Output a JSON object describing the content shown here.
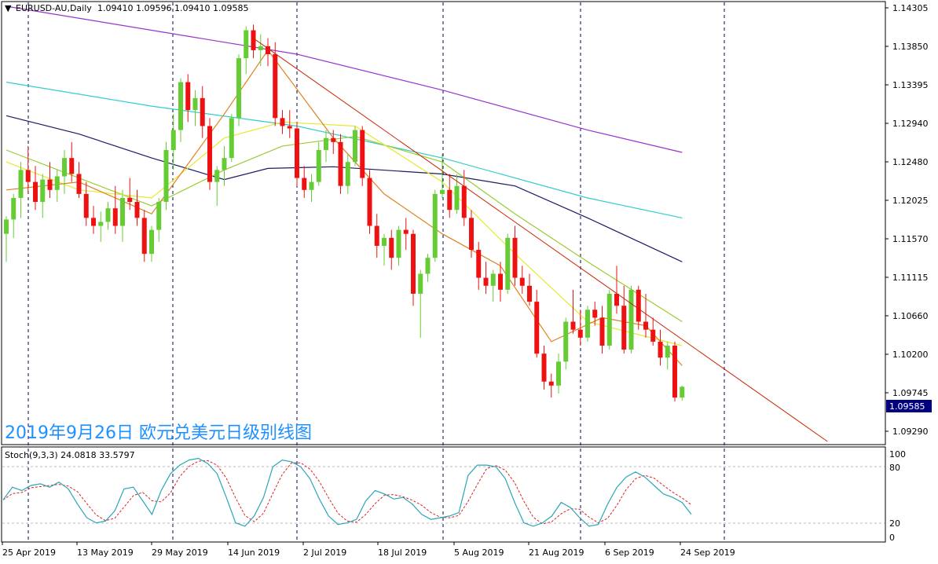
{
  "header": {
    "symbol": "EURUSD-AU,Daily",
    "ohlc": "1.09410 1.09596 1.09410 1.09585"
  },
  "caption": "2019年9月26日 欧元兑美元日级别线图",
  "price_tag": "1.09585",
  "stoch": {
    "label": "Stoch(9,3,3) 24.0818 33.5797",
    "levels": [
      "100",
      "80",
      "20",
      "0"
    ]
  },
  "price_axis": [
    "1.14305",
    "1.13850",
    "1.13395",
    "1.12940",
    "1.12480",
    "1.12025",
    "1.11570",
    "1.11115",
    "1.10660",
    "1.10200",
    "1.09745",
    "1.09290"
  ],
  "date_axis": [
    "25 Apr 2019",
    "13 May 2019",
    "29 May 2019",
    "14 Jun 2019",
    "2 Jul 2019",
    "18 Jul 2019",
    "5 Aug 2019",
    "21 Aug 2019",
    "6 Sep 2019",
    "24 Sep 2019"
  ],
  "colors": {
    "bull": "#66cc33",
    "bear": "#ee1111",
    "trendline": "#cc2200",
    "ma_purple": "#9933cc",
    "ma_cyan": "#33cccc",
    "ma_navy": "#1a1a66",
    "ma_green": "#99cc33",
    "ma_yellow": "#e8e830",
    "ma_orange": "#e08020",
    "stoch_main": "#2aa6b8",
    "stoch_signal": "#dd2222",
    "caption": "#1e90ff"
  },
  "chart_data": {
    "type": "candlestick",
    "title": "EURUSD-AU,Daily",
    "ylim": [
      1.089,
      1.1435
    ],
    "candles": [
      [
        1.115,
        1.1172,
        1.1115,
        1.1168
      ],
      [
        1.1168,
        1.12,
        1.1145,
        1.1195
      ],
      [
        1.1195,
        1.124,
        1.117,
        1.123
      ],
      [
        1.123,
        1.126,
        1.12,
        1.1215
      ],
      [
        1.1215,
        1.1235,
        1.118,
        1.119
      ],
      [
        1.119,
        1.1225,
        1.117,
        1.1218
      ],
      [
        1.1218,
        1.124,
        1.1195,
        1.1205
      ],
      [
        1.1205,
        1.123,
        1.119,
        1.1222
      ],
      [
        1.1222,
        1.1255,
        1.12,
        1.1245
      ],
      [
        1.1245,
        1.1265,
        1.1215,
        1.1225
      ],
      [
        1.1225,
        1.124,
        1.1195,
        1.12
      ],
      [
        1.12,
        1.1215,
        1.116,
        1.117
      ],
      [
        1.117,
        1.1185,
        1.115,
        1.116
      ],
      [
        1.116,
        1.1178,
        1.114,
        1.1165
      ],
      [
        1.1165,
        1.119,
        1.1155,
        1.1182
      ],
      [
        1.1182,
        1.121,
        1.115,
        1.116
      ],
      [
        1.116,
        1.1205,
        1.114,
        1.1195
      ],
      [
        1.1195,
        1.122,
        1.118,
        1.119
      ],
      [
        1.119,
        1.1205,
        1.116,
        1.117
      ],
      [
        1.117,
        1.118,
        1.1115,
        1.1125
      ],
      [
        1.1125,
        1.116,
        1.1115,
        1.1155
      ],
      [
        1.1155,
        1.1195,
        1.114,
        1.119
      ],
      [
        1.119,
        1.1265,
        1.118,
        1.1255
      ],
      [
        1.1255,
        1.13,
        1.123,
        1.128
      ],
      [
        1.128,
        1.1345,
        1.1265,
        1.134
      ],
      [
        1.134,
        1.135,
        1.129,
        1.1305
      ],
      [
        1.1305,
        1.133,
        1.1285,
        1.132
      ],
      [
        1.132,
        1.1335,
        1.127,
        1.1285
      ],
      [
        1.1285,
        1.1295,
        1.1205,
        1.1215
      ],
      [
        1.1215,
        1.1235,
        1.1185,
        1.123
      ],
      [
        1.123,
        1.126,
        1.121,
        1.1245
      ],
      [
        1.1245,
        1.13,
        1.124,
        1.1295
      ],
      [
        1.1295,
        1.1375,
        1.1285,
        1.137
      ],
      [
        1.137,
        1.141,
        1.135,
        1.1405
      ],
      [
        1.1405,
        1.1412,
        1.137,
        1.138
      ],
      [
        1.138,
        1.14,
        1.136,
        1.1385
      ],
      [
        1.1385,
        1.1395,
        1.136,
        1.1375
      ],
      [
        1.1375,
        1.139,
        1.1285,
        1.1295
      ],
      [
        1.1295,
        1.1305,
        1.1275,
        1.1285
      ],
      [
        1.1285,
        1.1305,
        1.127,
        1.1282
      ],
      [
        1.1282,
        1.129,
        1.121,
        1.122
      ],
      [
        1.122,
        1.1235,
        1.1195,
        1.1205
      ],
      [
        1.1205,
        1.1225,
        1.119,
        1.1215
      ],
      [
        1.1215,
        1.1265,
        1.121,
        1.1255
      ],
      [
        1.1255,
        1.128,
        1.124,
        1.127
      ],
      [
        1.127,
        1.128,
        1.125,
        1.1265
      ],
      [
        1.1265,
        1.1275,
        1.12,
        1.121
      ],
      [
        1.121,
        1.125,
        1.12,
        1.124
      ],
      [
        1.124,
        1.1285,
        1.1235,
        1.128
      ],
      [
        1.128,
        1.1285,
        1.121,
        1.122
      ],
      [
        1.122,
        1.123,
        1.115,
        1.116
      ],
      [
        1.116,
        1.1175,
        1.112,
        1.1135
      ],
      [
        1.1135,
        1.115,
        1.111,
        1.1145
      ],
      [
        1.1145,
        1.1155,
        1.1105,
        1.112
      ],
      [
        1.112,
        1.116,
        1.111,
        1.1155
      ],
      [
        1.1155,
        1.117,
        1.113,
        1.115
      ],
      [
        1.115,
        1.1155,
        1.106,
        1.1075
      ],
      [
        1.1075,
        1.1105,
        1.102,
        1.11
      ],
      [
        1.11,
        1.1125,
        1.109,
        1.112
      ],
      [
        1.112,
        1.1205,
        1.1115,
        1.12
      ],
      [
        1.12,
        1.125,
        1.1195,
        1.1205
      ],
      [
        1.1205,
        1.1225,
        1.117,
        1.118
      ],
      [
        1.118,
        1.1225,
        1.1175,
        1.121
      ],
      [
        1.121,
        1.123,
        1.116,
        1.117
      ],
      [
        1.117,
        1.118,
        1.112,
        1.113
      ],
      [
        1.113,
        1.114,
        1.108,
        1.1095
      ],
      [
        1.1095,
        1.1115,
        1.1075,
        1.1085
      ],
      [
        1.1085,
        1.1105,
        1.1065,
        1.11
      ],
      [
        1.11,
        1.1115,
        1.1065,
        1.108
      ],
      [
        1.108,
        1.115,
        1.1075,
        1.1145
      ],
      [
        1.1145,
        1.116,
        1.1085,
        1.1095
      ],
      [
        1.1095,
        1.111,
        1.1075,
        1.1085
      ],
      [
        1.1085,
        1.11,
        1.106,
        1.1065
      ],
      [
        1.1065,
        1.108,
        1.0995,
        1.1
      ],
      [
        1.1,
        1.101,
        1.0955,
        1.0965
      ],
      [
        1.0965,
        1.0975,
        1.0945,
        1.096
      ],
      [
        1.096,
        1.1,
        1.095,
        1.099
      ],
      [
        1.099,
        1.1045,
        1.098,
        1.104
      ],
      [
        1.104,
        1.108,
        1.1025,
        1.103
      ],
      [
        1.103,
        1.1055,
        1.101,
        1.102
      ],
      [
        1.102,
        1.106,
        1.1015,
        1.1055
      ],
      [
        1.1055,
        1.1065,
        1.1035,
        1.1045
      ],
      [
        1.1045,
        1.106,
        1.1,
        1.101
      ],
      [
        1.101,
        1.108,
        1.1005,
        1.1075
      ],
      [
        1.1075,
        1.111,
        1.105,
        1.106
      ],
      [
        1.106,
        1.1085,
        1.1,
        1.1005
      ],
      [
        1.1005,
        1.1085,
        1.1,
        1.108
      ],
      [
        1.108,
        1.1085,
        1.103,
        1.104
      ],
      [
        1.104,
        1.1075,
        1.102,
        1.103
      ],
      [
        1.103,
        1.1045,
        1.101,
        1.1015
      ],
      [
        1.1015,
        1.103,
        1.0985,
        1.0995
      ],
      [
        1.0995,
        1.1015,
        1.098,
        1.101
      ],
      [
        1.101,
        1.1015,
        1.094,
        1.0945
      ],
      [
        1.0945,
        1.096,
        1.0941,
        1.09585
      ]
    ],
    "moving_averages": [
      {
        "name": "MA purple",
        "color": "#9933cc",
        "points": [
          [
            0,
            1.1435
          ],
          [
            20,
            1.1405
          ],
          [
            40,
            1.1375
          ],
          [
            60,
            1.133
          ],
          [
            80,
            1.128
          ],
          [
            93,
            1.1252
          ]
        ]
      },
      {
        "name": "MA cyan",
        "color": "#33cccc",
        "points": [
          [
            0,
            1.134
          ],
          [
            20,
            1.131
          ],
          [
            40,
            1.1285
          ],
          [
            60,
            1.1245
          ],
          [
            80,
            1.1195
          ],
          [
            93,
            1.117
          ]
        ]
      },
      {
        "name": "MA navy",
        "color": "#1a1a66",
        "points": [
          [
            0,
            1.1298
          ],
          [
            10,
            1.1275
          ],
          [
            20,
            1.1245
          ],
          [
            30,
            1.1218
          ],
          [
            36,
            1.1232
          ],
          [
            45,
            1.1234
          ],
          [
            60,
            1.1225
          ],
          [
            70,
            1.121
          ],
          [
            80,
            1.117
          ],
          [
            93,
            1.1115
          ]
        ]
      },
      {
        "name": "MA green",
        "color": "#99cc33",
        "points": [
          [
            0,
            1.1255
          ],
          [
            10,
            1.122
          ],
          [
            20,
            1.1185
          ],
          [
            30,
            1.123
          ],
          [
            38,
            1.126
          ],
          [
            48,
            1.1272
          ],
          [
            60,
            1.124
          ],
          [
            70,
            1.1175
          ],
          [
            80,
            1.1115
          ],
          [
            93,
            1.104
          ]
        ]
      },
      {
        "name": "MA yellow",
        "color": "#e8e830",
        "points": [
          [
            0,
            1.124
          ],
          [
            10,
            1.1205
          ],
          [
            20,
            1.1195
          ],
          [
            30,
            1.127
          ],
          [
            38,
            1.129
          ],
          [
            48,
            1.1285
          ],
          [
            60,
            1.1215
          ],
          [
            70,
            1.1125
          ],
          [
            80,
            1.104
          ],
          [
            93,
            1.101
          ]
        ]
      },
      {
        "name": "MA orange",
        "color": "#e08020",
        "points": [
          [
            0,
            1.1205
          ],
          [
            10,
            1.1215
          ],
          [
            20,
            1.1175
          ],
          [
            30,
            1.13
          ],
          [
            36,
            1.138
          ],
          [
            45,
            1.127
          ],
          [
            52,
            1.12
          ],
          [
            60,
            1.115
          ],
          [
            68,
            1.111
          ],
          [
            75,
            1.1015
          ],
          [
            82,
            1.1045
          ],
          [
            88,
            1.1035
          ],
          [
            93,
            1.0985
          ]
        ]
      }
    ],
    "trendline": {
      "from": [
        34,
        1.1395
      ],
      "to": [
        113,
        1.089
      ]
    },
    "stochastic": {
      "main": [
        45,
        60,
        56,
        62,
        64,
        60,
        66,
        58,
        40,
        24,
        18,
        20,
        32,
        58,
        60,
        44,
        28,
        56,
        76,
        86,
        92,
        94,
        88,
        76,
        48,
        18,
        14,
        26,
        48,
        84,
        92,
        90,
        84,
        70,
        46,
        26,
        16,
        18,
        22,
        44,
        56,
        52,
        46,
        48,
        40,
        28,
        22,
        24,
        26,
        30,
        74,
        86,
        86,
        84,
        70,
        42,
        18,
        14,
        18,
        26,
        42,
        36,
        24,
        14,
        16,
        40,
        60,
        72,
        78,
        72,
        62,
        52,
        48,
        42,
        28
      ]
    }
  }
}
